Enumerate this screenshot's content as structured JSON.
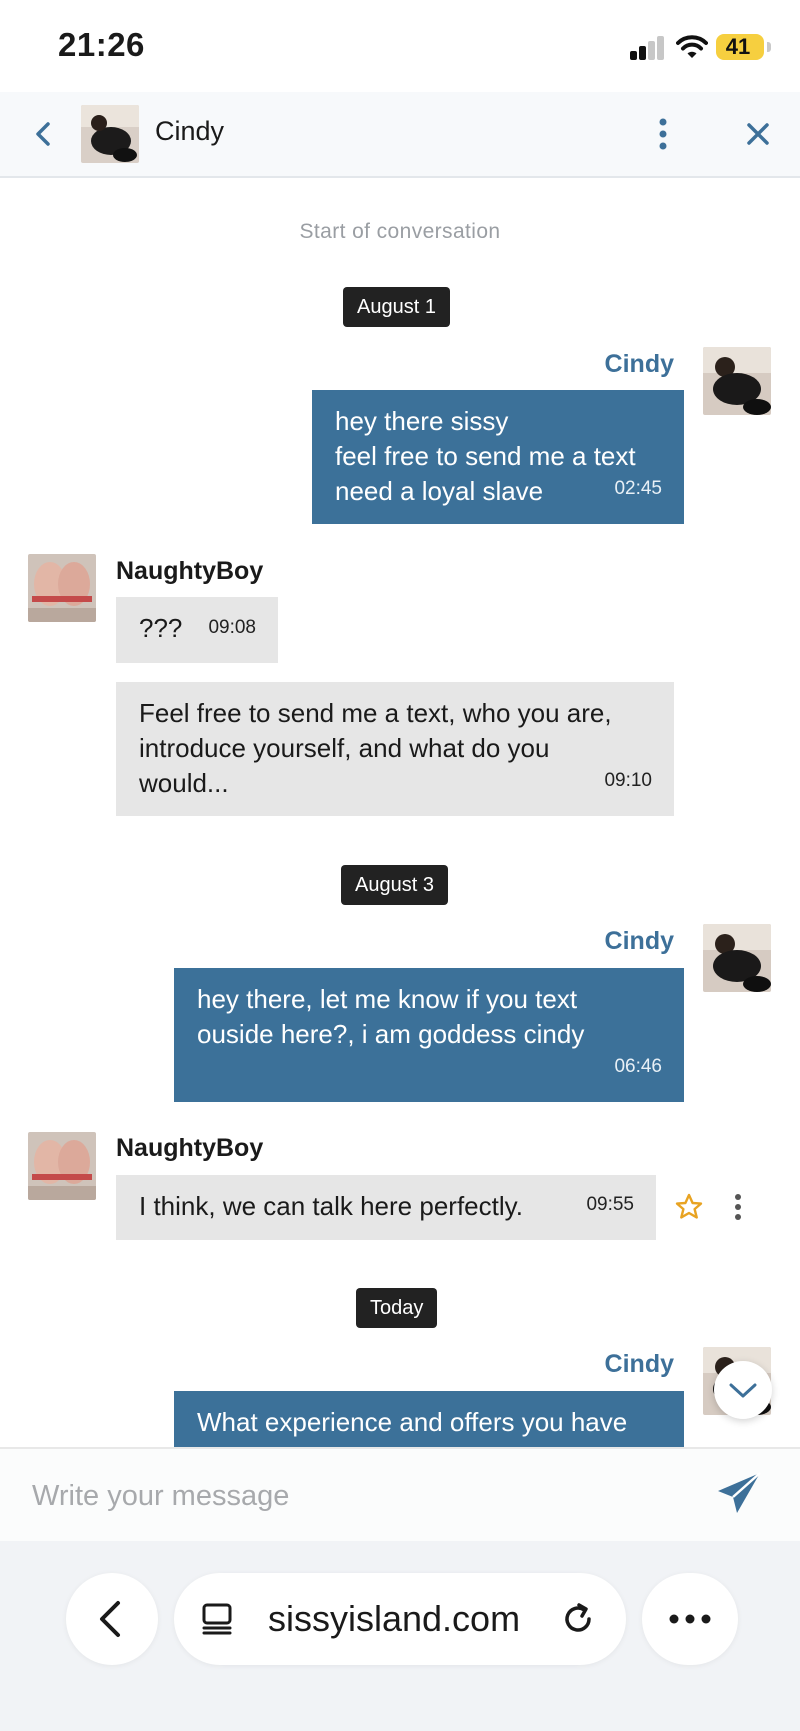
{
  "status_bar": {
    "time": "21:26",
    "battery": "41"
  },
  "header": {
    "contact_name": "Cindy"
  },
  "conversation": {
    "start_note": "Start of conversation",
    "dates": [
      "August 1",
      "August 3",
      "Today"
    ],
    "messages": [
      {
        "sender": "Cindy",
        "text": "hey there sissy\nfeel free to send me a text\nneed a loyal slave",
        "time": "02:45"
      },
      {
        "sender": "NaughtyBoy",
        "text": "???",
        "time": "09:08"
      },
      {
        "sender": "",
        "text": "Feel free to send me a text, who you are,\nintroduce yourself, and what do you\nwould...",
        "time": "09:10"
      },
      {
        "sender": "Cindy",
        "text": "hey there, let me know if you text\nouside here?, i am goddess cindy",
        "time": "06:46"
      },
      {
        "sender": "NaughtyBoy",
        "text": "I think, we can talk here perfectly.",
        "time": "09:55"
      },
      {
        "sender": "Cindy",
        "text": "What experience and offers you have"
      }
    ]
  },
  "composer": {
    "placeholder": "Write your message"
  },
  "browser": {
    "url": "sissyisland.com"
  },
  "colors": {
    "outgoing_bubble": "#3c7199",
    "incoming_bubble": "#e6e6e6",
    "accent": "#3d7099",
    "date_chip": "#222222",
    "star": "#e8a322",
    "battery": "#f6cf3f"
  },
  "icons": {
    "back": "chevron-left-icon",
    "menu": "more-vertical-icon",
    "close": "close-icon",
    "star": "star-icon",
    "send": "send-icon",
    "scroll": "chevron-down-icon"
  }
}
